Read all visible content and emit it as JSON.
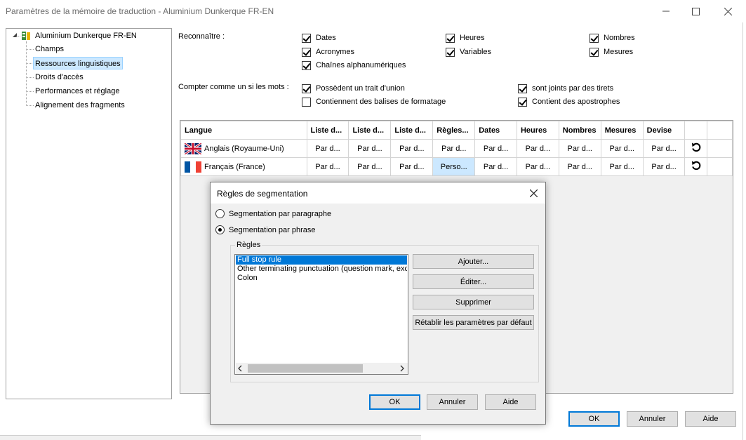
{
  "window": {
    "title": "Paramètres de la mémoire de traduction - Aluminium Dunkerque FR-EN",
    "minimize_icon": "minimize-icon",
    "maximize_icon": "maximize-icon",
    "close_icon": "close-icon"
  },
  "tree": {
    "root": {
      "label": "Aluminium Dunkerque FR-EN",
      "icon": "translation-memory-icon",
      "expanded": true
    },
    "items": [
      {
        "label": "Champs",
        "selected": false
      },
      {
        "label": "Ressources linguistiques",
        "selected": true
      },
      {
        "label": "Droits d'accès",
        "selected": false
      },
      {
        "label": "Performances et réglage",
        "selected": false
      },
      {
        "label": "Alignement des fragments",
        "selected": false
      }
    ]
  },
  "recognize": {
    "label": "Reconnaître :",
    "options": [
      {
        "label": "Dates",
        "checked": true
      },
      {
        "label": "Heures",
        "checked": true
      },
      {
        "label": "Nombres",
        "checked": true
      },
      {
        "label": "Acronymes",
        "checked": true
      },
      {
        "label": "Variables",
        "checked": true
      },
      {
        "label": "Mesures",
        "checked": true
      },
      {
        "label": "Chaînes alphanumériques",
        "checked": true
      }
    ]
  },
  "count_words": {
    "label": "Compter comme un si les mots :",
    "options": [
      {
        "label": "Possèdent un trait d'union",
        "checked": true
      },
      {
        "label": "sont joints par des tirets",
        "checked": true
      },
      {
        "label": "Contiennent des balises de formatage",
        "checked": false
      },
      {
        "label": "Contient des apostrophes",
        "checked": true
      }
    ]
  },
  "grid": {
    "headers": [
      "Langue",
      "Liste d...",
      "Liste d...",
      "Liste d...",
      "Règles...",
      "Dates",
      "Heures",
      "Nombres",
      "Mesures",
      "Devise",
      "",
      ""
    ],
    "rows": [
      {
        "flag": "uk-flag-icon",
        "language": "Anglais (Royaume-Uni)",
        "values": [
          "Par d...",
          "Par d...",
          "Par d...",
          "Par d...",
          "Par d...",
          "Par d...",
          "Par d...",
          "Par d...",
          "Par d..."
        ],
        "reset_icon": "reset-icon"
      },
      {
        "flag": "france-flag-icon",
        "language": "Français (France)",
        "values": [
          "Par d...",
          "Par d...",
          "Par d...",
          "Perso...",
          "Par d...",
          "Par d...",
          "Par d...",
          "Par d...",
          "Par d..."
        ],
        "reset_icon": "reset-icon"
      }
    ]
  },
  "dialog": {
    "title": "Règles de segmentation",
    "radio_paragraph": {
      "label": "Segmentation par paragraphe",
      "selected": false
    },
    "radio_sentence": {
      "label": "Segmentation par phrase",
      "selected": true
    },
    "group_label": "Règles",
    "rules": [
      {
        "label": "Full stop rule",
        "selected": true
      },
      {
        "label": "Other terminating punctuation (question mark, excla",
        "selected": false
      },
      {
        "label": "Colon",
        "selected": false
      }
    ],
    "buttons": {
      "add": "Ajouter...",
      "edit": "Éditer...",
      "delete": "Supprimer",
      "reset": "Rétablir les paramètres par défaut",
      "ok": "OK",
      "cancel": "Annuler",
      "help": "Aide"
    }
  },
  "footer": {
    "ok": "OK",
    "cancel": "Annuler",
    "help": "Aide"
  },
  "colors": {
    "selection": "#cce8ff",
    "list_selection": "#0078d7",
    "button_face": "#e1e1e1",
    "dialog_bg": "#f0f0f0"
  }
}
